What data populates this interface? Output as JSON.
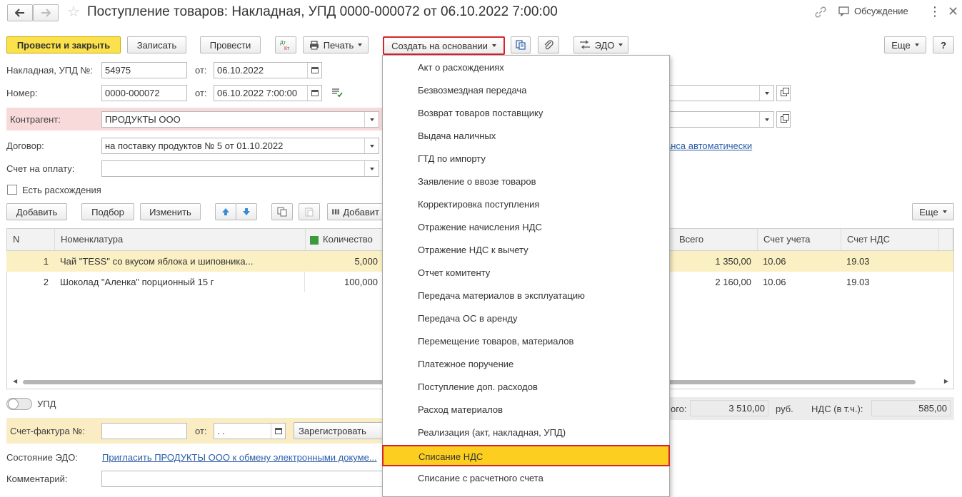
{
  "window": {
    "title": "Поступление товаров: Накладная, УПД 0000-000072 от 06.10.2022 7:00:00",
    "discussion_label": "Обсуждение"
  },
  "toolbar": {
    "post_close": "Провести и закрыть",
    "save": "Записать",
    "post": "Провести",
    "dtkt": "Дт Кт",
    "print": "Печать",
    "create_based": "Создать на основании",
    "edo": "ЭДО",
    "more": "Еще",
    "help": "?"
  },
  "form": {
    "invoice_label": "Накладная, УПД №:",
    "invoice_no": "54975",
    "from_label": "от:",
    "invoice_date": "06.10.2022",
    "number_label": "Номер:",
    "number": "0000-000072",
    "number_date": "06.10.2022  7:00:00",
    "counterparty_label": "Контрагент:",
    "counterparty": "ПРОДУКТЫ ООО",
    "contract_label": "Договор:",
    "contract": "на поставку продуктов № 5 от 01.10.2022",
    "payment_label": "Счет на оплату:",
    "payment": "",
    "discrepancy_label": "Есть расхождения",
    "advance_link": "анса автоматически"
  },
  "table_toolbar": {
    "add": "Добавить",
    "pick": "Подбор",
    "change": "Изменить",
    "add_barcode": "Добавит",
    "more": "Еще"
  },
  "table": {
    "headers": {
      "n": "N",
      "item": "Номенклатура",
      "qty": "Количество",
      "total": "Всего",
      "account": "Счет учета",
      "vat_account": "Счет НДС"
    },
    "rows": [
      {
        "n": "1",
        "item": "Чай \"TESS\" со вкусом яблока и шиповника...",
        "qty": "5,000",
        "total": "1 350,00",
        "account": "10.06",
        "vat_account": "19.03"
      },
      {
        "n": "2",
        "item": "Шоколад \"Аленка\" порционный 15 г",
        "qty": "100,000",
        "total": "2 160,00",
        "account": "10.06",
        "vat_account": "19.03"
      }
    ]
  },
  "footer": {
    "upd_label": "УПД",
    "total_label_tail": "ого:",
    "total": "3 510,00",
    "currency": "руб.",
    "vat_label": "НДС (в т.ч.):",
    "vat": "585,00",
    "invoice_label": "Счет-фактура №:",
    "invoice_no": "",
    "from_label": "от:",
    "invoice_date": " .  .",
    "register": "Зарегистровать",
    "edo_state_label": "Состояние ЭДО:",
    "edo_state_link": "Пригласить ПРОДУКТЫ ООО к обмену электронными докуме...",
    "comment_label": "Комментарий:"
  },
  "menu": {
    "items": [
      "Акт о расхождениях",
      "Безвозмездная передача",
      "Возврат товаров поставщику",
      "Выдача наличных",
      "ГТД по импорту",
      "Заявление о ввозе товаров",
      "Корректировка поступления",
      "Отражение начисления НДС",
      "Отражение НДС к вычету",
      "Отчет комитенту",
      "Передача материалов в эксплуатацию",
      "Передача ОС в аренду",
      "Перемещение товаров, материалов",
      "Платежное поручение",
      "Поступление доп. расходов",
      "Расход материалов",
      "Реализация (акт, накладная, УПД)",
      "Списание НДС",
      "Списание с расчетного счета"
    ],
    "highlighted_index": 17
  },
  "colors": {
    "accent_yellow": "#fbe14b",
    "highlight": "#fbce1f",
    "selected_row": "#fbf0c3",
    "required_pink": "#f9dada",
    "red_frame": "#d6252a",
    "link": "#2a5da8"
  }
}
